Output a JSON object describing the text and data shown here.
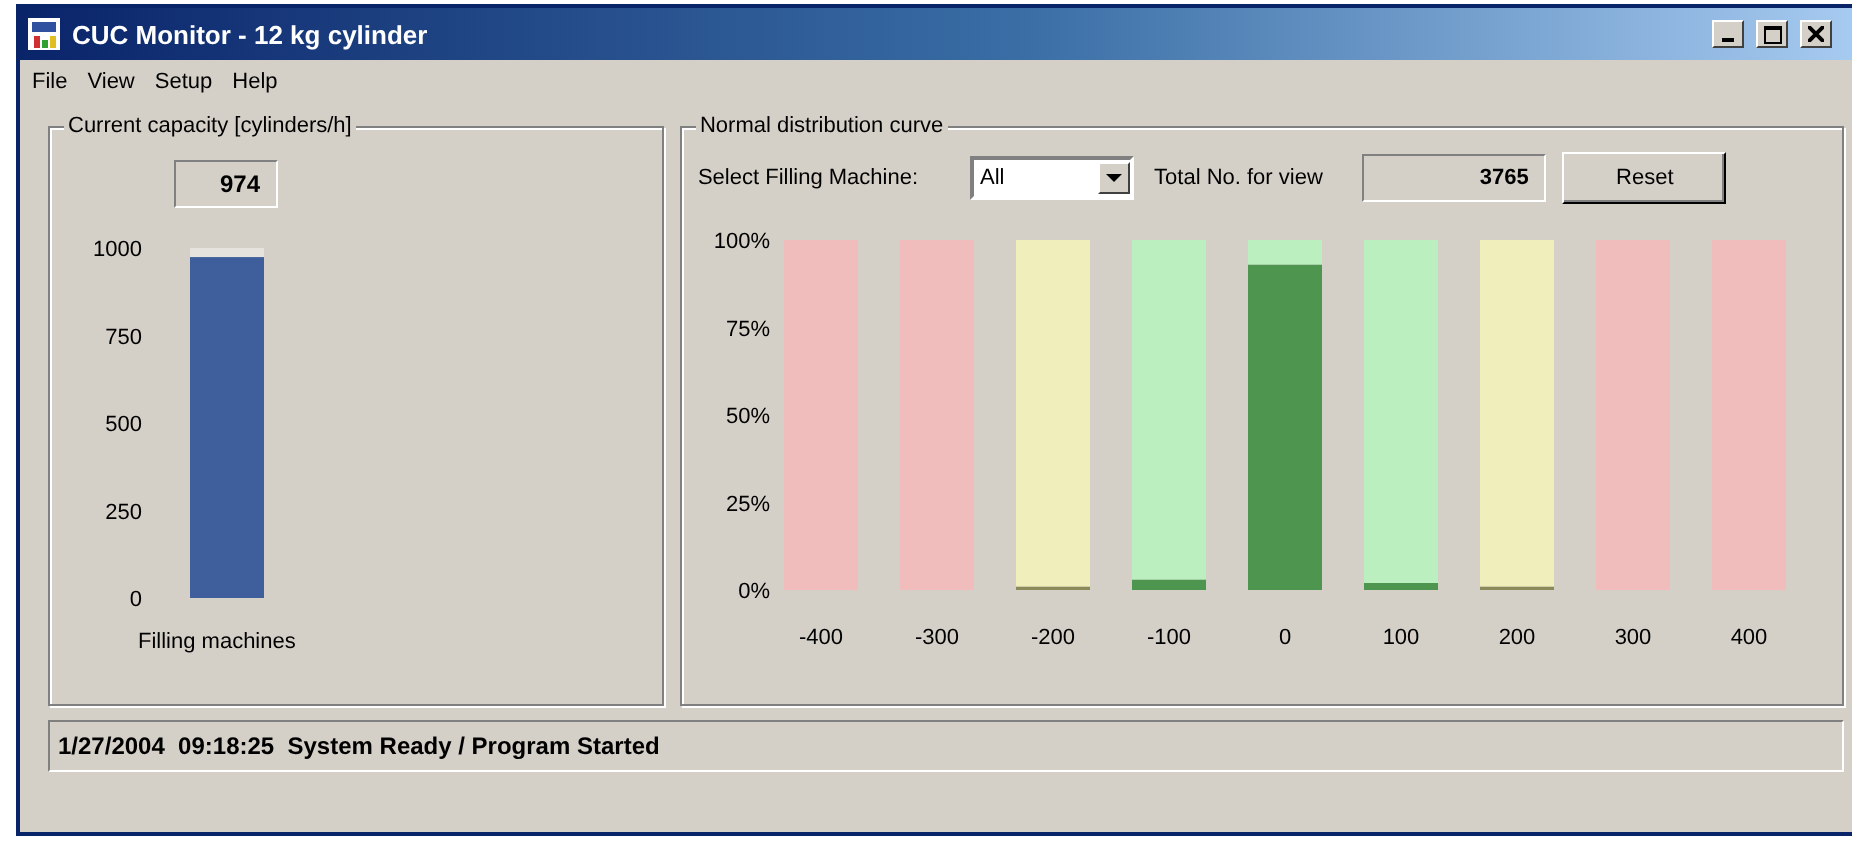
{
  "window": {
    "title": "CUC Monitor - 12 kg cylinder"
  },
  "menu": [
    "File",
    "View",
    "Setup",
    "Help"
  ],
  "capacity": {
    "title": "Current capacity [cylinders/h]",
    "value": "974",
    "chart_data": {
      "type": "bar",
      "ylim": [
        0,
        1000
      ],
      "yticks": [
        0,
        250,
        500,
        750,
        1000
      ],
      "categories": [
        "Filling machines"
      ],
      "series": [
        {
          "color": "#3f5f9c",
          "values": [
            974
          ]
        }
      ]
    }
  },
  "distribution": {
    "title": "Normal distribution curve",
    "select_label": "Select Filling Machine:",
    "machine": "All",
    "total_label": "Total No. for view",
    "total": "3765",
    "reset": "Reset",
    "chart_data": {
      "type": "bar",
      "ylim": [
        0,
        100
      ],
      "yticks": [
        {
          "value": 0,
          "label": "0%"
        },
        {
          "value": 25,
          "label": "25%"
        },
        {
          "value": 50,
          "label": "50%"
        },
        {
          "value": 75,
          "label": "75%"
        },
        {
          "value": 100,
          "label": "100%"
        }
      ],
      "categories": [
        "-400",
        "-300",
        "-200",
        "-100",
        "0",
        "100",
        "200",
        "300",
        "400"
      ],
      "stacked": true,
      "series": [
        {
          "color": "#8a8a5a",
          "values": [
            null,
            null,
            1,
            null,
            null,
            null,
            1,
            null,
            null
          ]
        },
        {
          "color": "#4e9650",
          "values": [
            null,
            null,
            null,
            3,
            93,
            2,
            null,
            null,
            null
          ]
        },
        {
          "color": "#f0bcbc",
          "values": [
            100,
            100,
            null,
            null,
            null,
            null,
            null,
            100,
            100
          ]
        },
        {
          "color": "#f0efbc",
          "values": [
            null,
            null,
            99,
            null,
            null,
            null,
            99,
            null,
            null
          ]
        },
        {
          "color": "#bcefc0",
          "values": [
            null,
            null,
            null,
            97,
            7,
            98,
            null,
            null,
            null
          ]
        }
      ]
    }
  },
  "status_bar": "1/27/2004  09:18:25  System Ready / Program Started"
}
